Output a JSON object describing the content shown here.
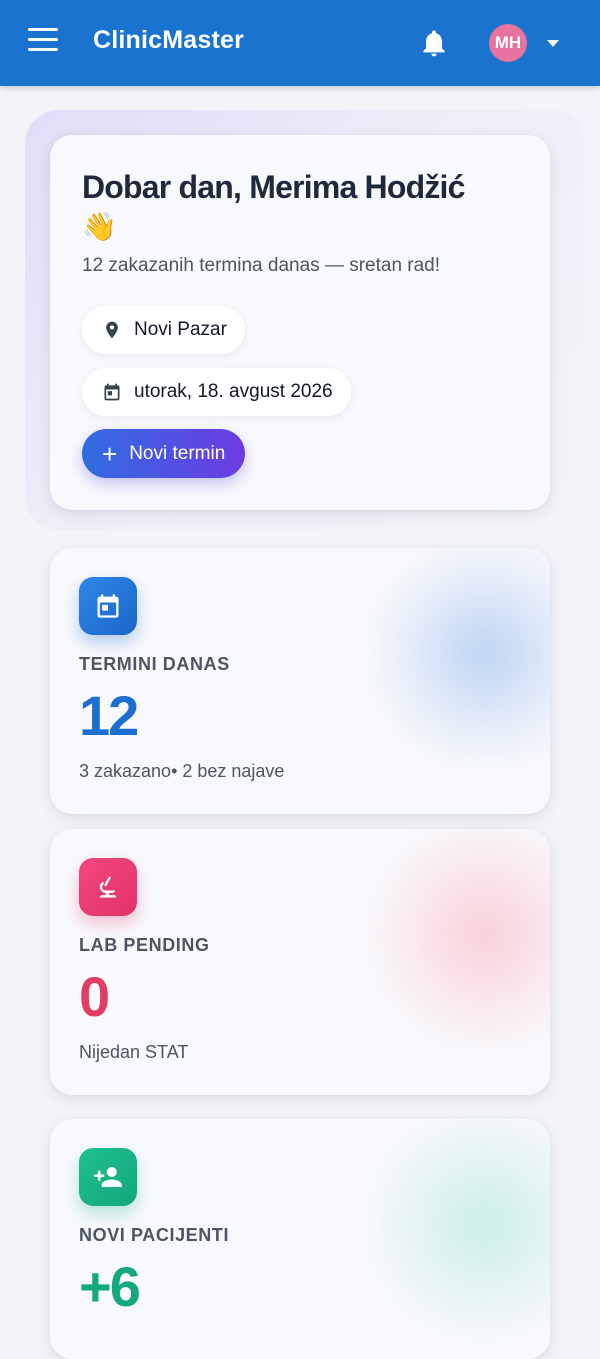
{
  "app": {
    "title": "ClinicMaster",
    "user_initials": "MH"
  },
  "greeting": {
    "headline": "Dobar dan, Merima Hodžić",
    "emoji": "👋",
    "subtitle": "12 zakazanih termina danas — sretan rad!",
    "location": "Novi Pazar",
    "date": "utorak, 18. avgust 2026",
    "new_appointment_label": "Novi termin"
  },
  "stats": [
    {
      "label": "TERMINI DANAS",
      "value": "12",
      "note": "3 zakazano• 2 bez najave",
      "icon": "calendar-icon",
      "color": "#1a6fd0"
    },
    {
      "label": "LAB PENDING",
      "value": "0",
      "note": "Nijedan STAT",
      "icon": "microscope-icon",
      "color": "#e23d65"
    },
    {
      "label": "NOVI PACIJENTI",
      "value": "+6",
      "note": "",
      "icon": "person-add-icon",
      "color": "#14a97b"
    }
  ],
  "colors": {
    "appbar": "#1a73cf",
    "button_gradient_start": "#2f6de0",
    "button_gradient_end": "#6d3be3"
  }
}
